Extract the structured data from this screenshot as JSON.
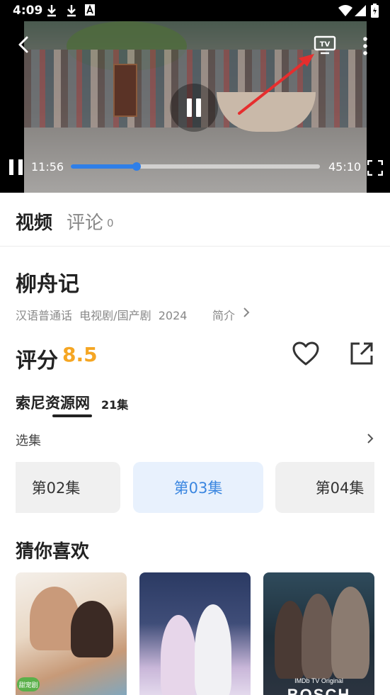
{
  "status_bar": {
    "time": "4:09",
    "icons": [
      "download-icon",
      "download-icon",
      "font-a-icon",
      "wifi-icon",
      "signal-icon",
      "battery-icon"
    ]
  },
  "player": {
    "current_time": "11:56",
    "total_time": "45:10",
    "progress": 0.265,
    "accent_color": "#2f7fe8",
    "icons": [
      "back-icon",
      "tv-cast-icon",
      "more-vertical-icon",
      "pause-icon",
      "fullscreen-icon"
    ]
  },
  "tabs": {
    "video": "视频",
    "comments": "评论",
    "comments_count": "0"
  },
  "show": {
    "title": "柳舟记",
    "meta": "汉语普通话  电视剧/国产剧  2024",
    "intro_label": "简介",
    "score_label": "评分",
    "score_value": "8.5",
    "score_color": "#f5a623"
  },
  "source": {
    "name": "索尼资源网",
    "episode_count": "21集"
  },
  "episodes": {
    "label": "选集",
    "items": [
      {
        "label": "第02集",
        "active": false
      },
      {
        "label": "第03集",
        "active": true
      },
      {
        "label": "第04集",
        "active": false
      }
    ]
  },
  "recommendations": {
    "title": "猜你喜欢",
    "posters": [
      {
        "badge": "甜宠剧"
      },
      {},
      {
        "caption_small": "IMDb TV Original",
        "caption_big": "BOSCH"
      }
    ]
  }
}
